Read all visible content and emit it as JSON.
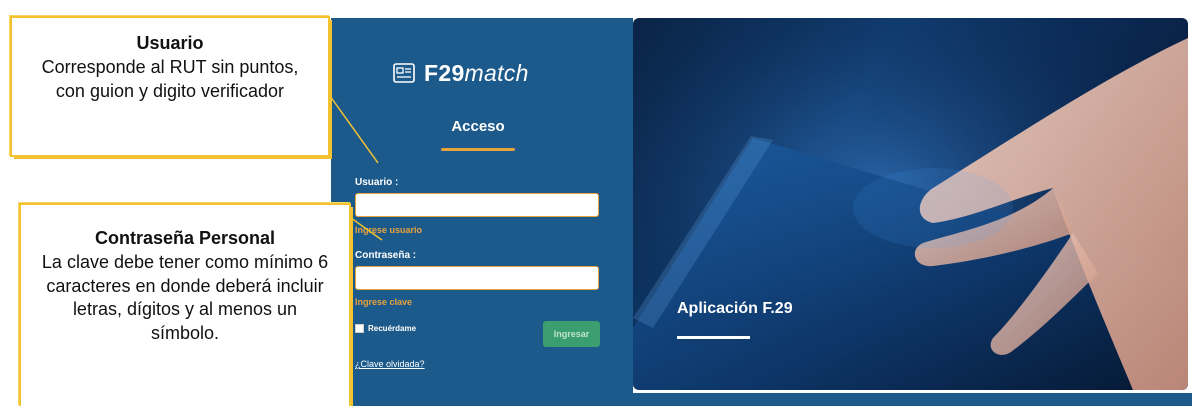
{
  "login": {
    "app_name_bold": "F29",
    "app_name_italic": "match",
    "section_title": "Acceso",
    "user_label": "Usuario :",
    "user_hint": "Ingrese usuario",
    "password_label": "Contraseña :",
    "password_hint": "Ingrese clave",
    "remember_label": "Recuérdame",
    "submit_label": "Ingresar",
    "forgot_link": "¿Clave olvidada?"
  },
  "banner": {
    "title": "Aplicación F.29"
  },
  "annotations": {
    "user": {
      "title": "Usuario",
      "text": "Corresponde al RUT sin puntos, con guion y digito verificador"
    },
    "password": {
      "title": "Contraseña Personal",
      "text": "La clave debe tener como mínimo 6 caracteres en donde deberá incluir letras, dígitos y al menos un símbolo."
    }
  },
  "colors": {
    "panel_blue": "#1d5a8c",
    "accent_orange": "#e8a23b",
    "button_green": "#3a9e6e",
    "callout_yellow": "#f2c230"
  }
}
